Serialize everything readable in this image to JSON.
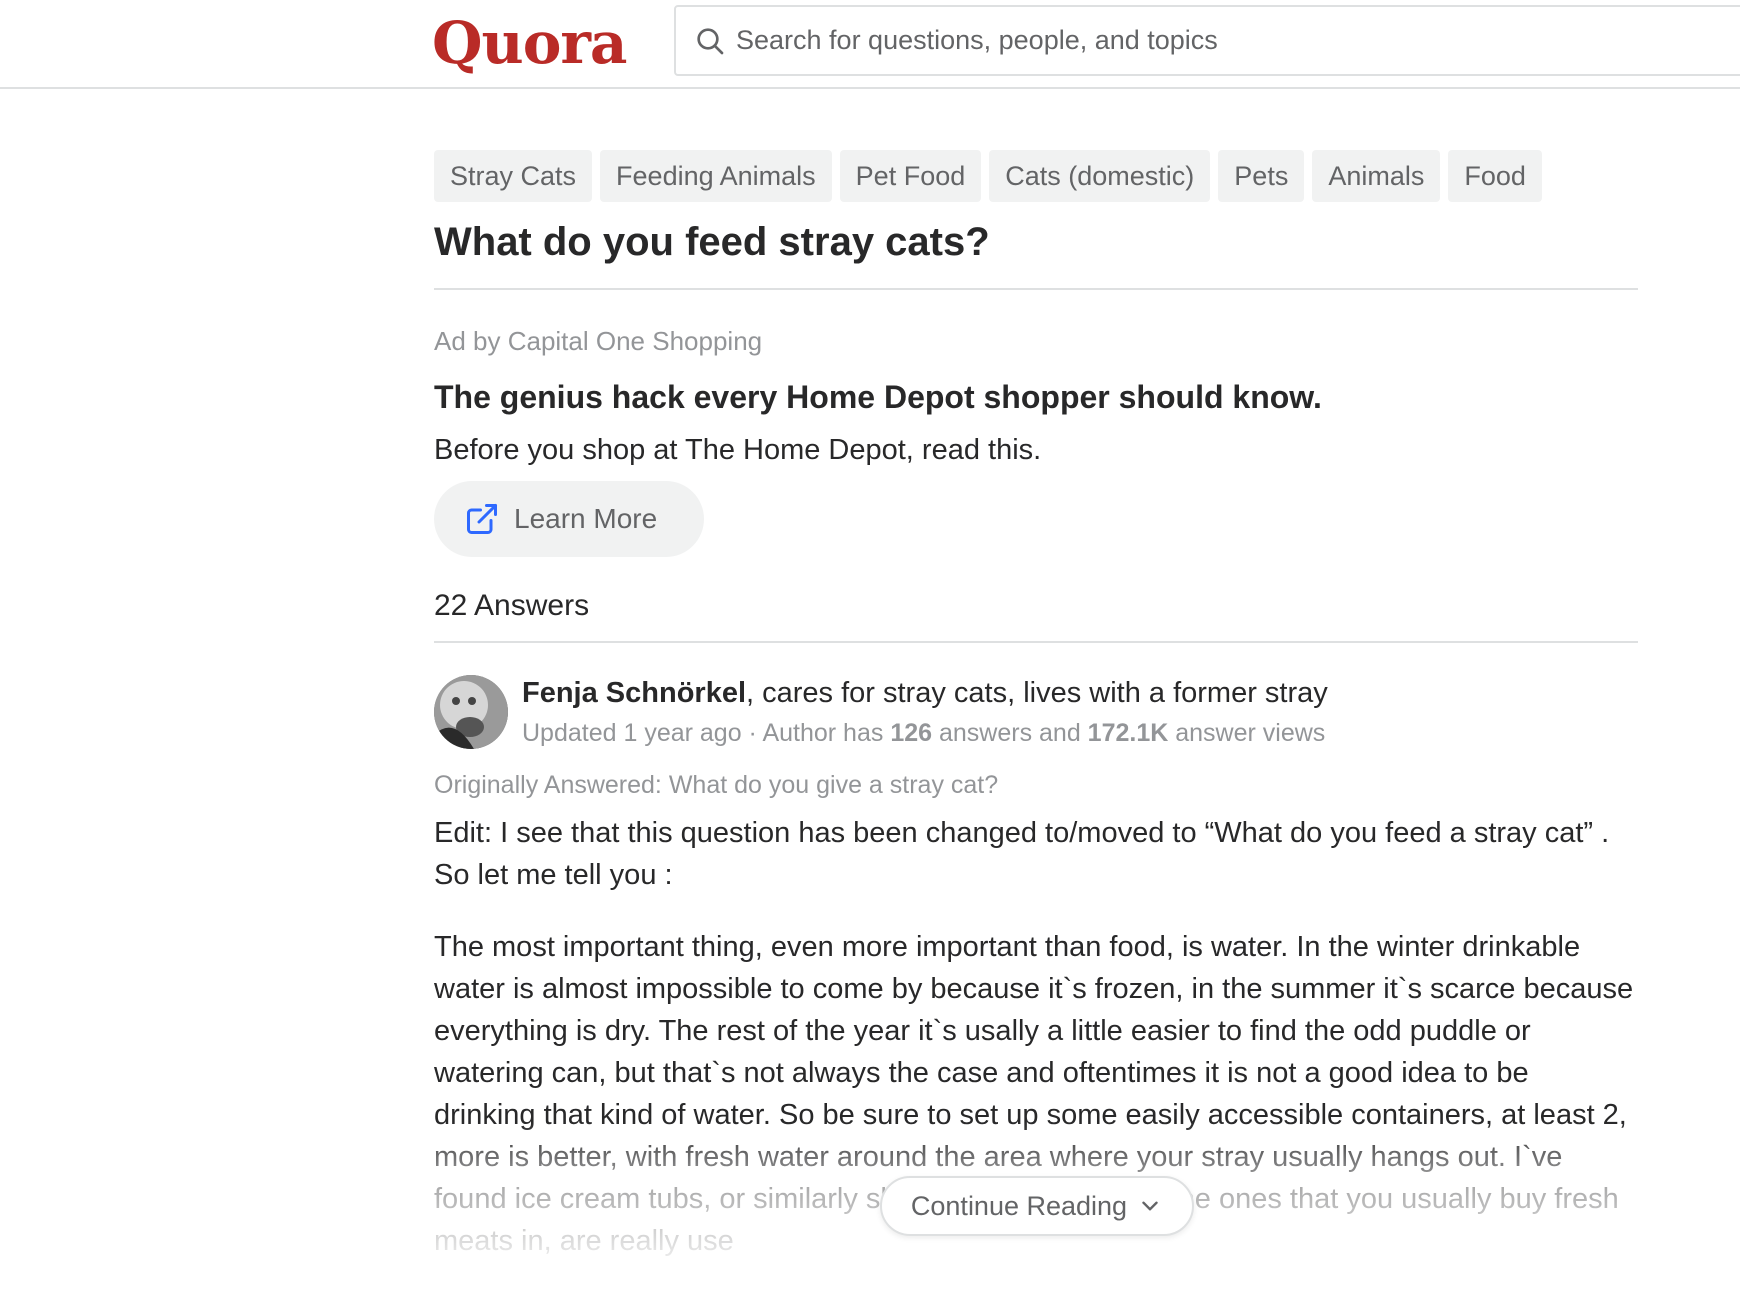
{
  "header": {
    "logo": "Quora",
    "search_placeholder": "Search for questions, people, and topics"
  },
  "topics": [
    "Stray Cats",
    "Feeding Animals",
    "Pet Food",
    "Cats (domestic)",
    "Pets",
    "Animals",
    "Food"
  ],
  "question": {
    "title": "What do you feed stray cats?"
  },
  "ad": {
    "label": "Ad by Capital One Shopping",
    "title": "The genius hack every Home Depot shopper should know.",
    "description": "Before you shop at The Home Depot, read this.",
    "button_label": "Learn More"
  },
  "answers_count": "22 Answers",
  "answer": {
    "author_name": "Fenja Schnörkel",
    "author_credential": ", cares for stray cats, lives with a former stray",
    "meta_prefix": "Updated 1 year ago · Author has ",
    "answers_num": "126",
    "meta_middle": " answers and ",
    "views_num": "172.1K",
    "meta_suffix": " answer views",
    "originally_answered": "Originally Answered: What do you give a stray cat?",
    "paragraph1": "Edit: I see that this question has been changed to/moved to “What do you feed a stray cat” . So let me tell you :",
    "paragraph2": "The most important thing, even more important than food, is water. In the winter drinkable water is almost impossible to come by because it`s frozen, in the summer it`s scarce because everything is dry. The rest of the year it`s usally a little easier to find the odd puddle or watering can, but that`s not always the case and oftentimes it is not a good idea to be drinking that kind of water. So be sure to set up some easily accessible containers, at least 2, more is better, with fresh water around the area where your stray usually hangs out. I`ve found ice cream tubs, or similarly shaped containers, like the ones that you usually buy fresh meats in, are really use",
    "continue_label": "Continue Reading"
  }
}
